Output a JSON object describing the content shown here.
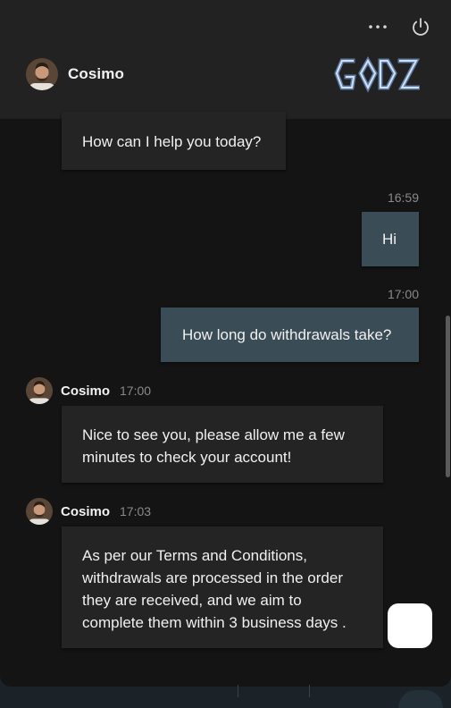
{
  "header": {
    "agent_name": "Cosimo",
    "menu_icon": "more-horizontal-icon",
    "power_icon": "power-icon",
    "logo_text": "GODZ"
  },
  "messages": [
    {
      "sender": "agent",
      "text": "How can I help you today?"
    },
    {
      "sender": "user",
      "time": "16:59",
      "text": "Hi"
    },
    {
      "sender": "user",
      "time": "17:00",
      "text": "How long do withdrawals take?"
    },
    {
      "sender": "agent",
      "name": "Cosimo",
      "time": "17:00",
      "lines": [
        "Nice to see you, please allow me a few",
        "minutes to check your account!"
      ]
    },
    {
      "sender": "agent",
      "name": "Cosimo",
      "time": "17:03",
      "lines": [
        "As per our Terms and Conditions,",
        "withdrawals are processed in the order",
        "they are received, and we aim to",
        "complete them within 3 business days ."
      ]
    }
  ],
  "colors": {
    "background": "#141414",
    "header": "#222222",
    "agent_bubble": "#242424",
    "user_bubble": "#3a4d56",
    "muted_text": "#8a8a8a"
  }
}
